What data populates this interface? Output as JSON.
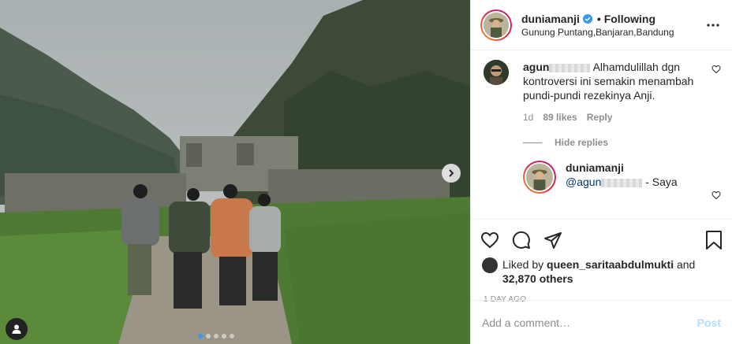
{
  "post": {
    "author": "duniamanji",
    "following_label": "• Following",
    "location": "Gunung Puntang,Banjaran,Bandung",
    "more_icon": "more-horizontal-icon"
  },
  "comments": [
    {
      "username_visible": "agun",
      "text": "Alhamdulillah dgn kontroversi ini semakin menambah pundi-pundi rezekinya Anji.",
      "age": "1d",
      "likes": "89 likes",
      "reply_label": "Reply",
      "hide_replies": "Hide replies",
      "replies": [
        {
          "username": "duniamanji",
          "mention_visible": "@agun",
          "text_suffix": "- Saya"
        }
      ]
    }
  ],
  "likes": {
    "prefix": "Liked by",
    "user": "queen_saritaabdulmukti",
    "and": "and",
    "others": "32,870 others"
  },
  "timestamp": "1 DAY AGO",
  "add_comment": {
    "placeholder": "Add a comment…",
    "post_label": "Post"
  },
  "carousel": {
    "total": 5,
    "active_index": 1
  },
  "colors": {
    "accent": "#3897f0",
    "verified": "#3897f0",
    "post_disabled": "#b2dffc",
    "muted": "#8e8e8e"
  }
}
